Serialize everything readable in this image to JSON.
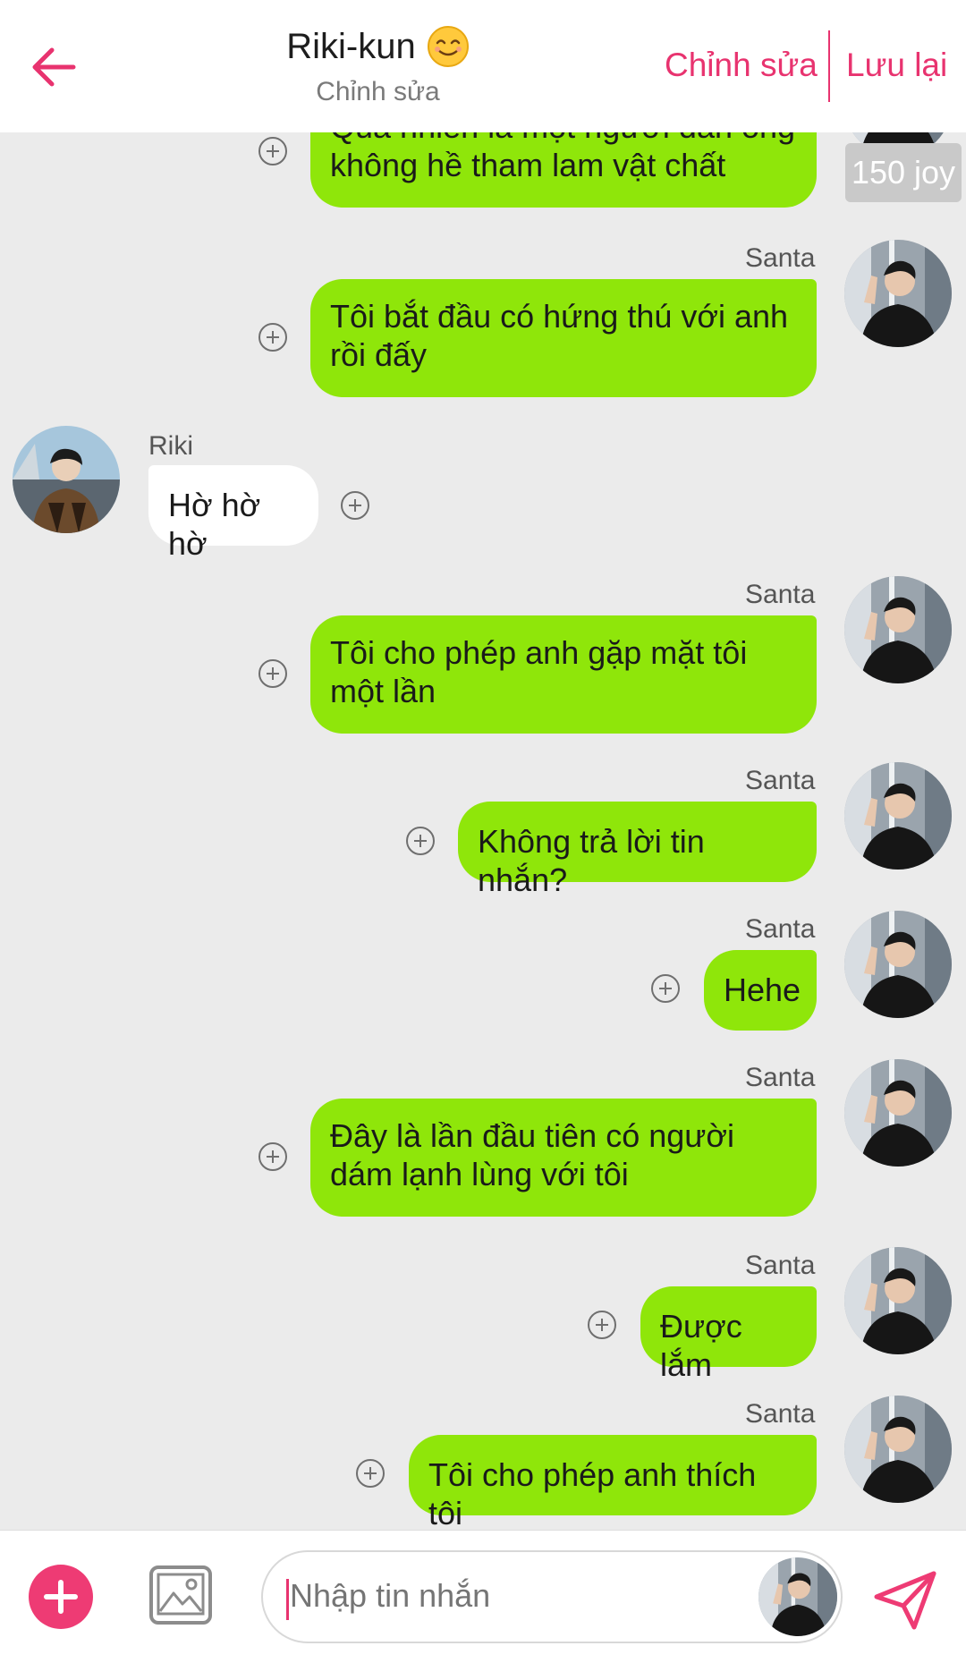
{
  "header": {
    "title": "Riki-kun",
    "subtitle": "Chỉnh sửa",
    "edit_label": "Chỉnh sửa",
    "save_label": "Lưu lại",
    "accent": "#e8336f"
  },
  "chat": {
    "joy_badge": "150 joy",
    "messages": [
      {
        "sender": "",
        "side": "out",
        "lines": [
          "Quả nhiên là một người đàn ông",
          "không hề tham lam vật chất"
        ]
      },
      {
        "sender": "Santa",
        "side": "out",
        "lines": [
          "Tôi bắt đầu có hứng thú với anh",
          "rồi đấy"
        ]
      },
      {
        "sender": "Riki",
        "side": "in",
        "lines": [
          "Hờ hờ hờ"
        ]
      },
      {
        "sender": "Santa",
        "side": "out",
        "lines": [
          "Tôi cho phép anh gặp mặt tôi",
          "một lần"
        ]
      },
      {
        "sender": "Santa",
        "side": "out",
        "lines": [
          "Không trả lời tin nhắn?"
        ]
      },
      {
        "sender": "Santa",
        "side": "out",
        "lines": [
          "Hehe"
        ]
      },
      {
        "sender": "Santa",
        "side": "out",
        "lines": [
          "Đây là lần đầu tiên có người",
          "dám lạnh lùng với tôi"
        ]
      },
      {
        "sender": "Santa",
        "side": "out",
        "lines": [
          "Được lắm"
        ]
      },
      {
        "sender": "Santa",
        "side": "out",
        "lines": [
          "Tôi cho phép anh thích tôi"
        ]
      }
    ],
    "out_color": "#8fe60a",
    "in_color": "#ffffff"
  },
  "input": {
    "placeholder": "Nhập tin nhắn"
  },
  "icons": {
    "back": "arrow-left-icon",
    "add": "plus-icon",
    "image": "image-icon",
    "send": "send-icon",
    "bubble_add": "plus-circle-icon"
  }
}
